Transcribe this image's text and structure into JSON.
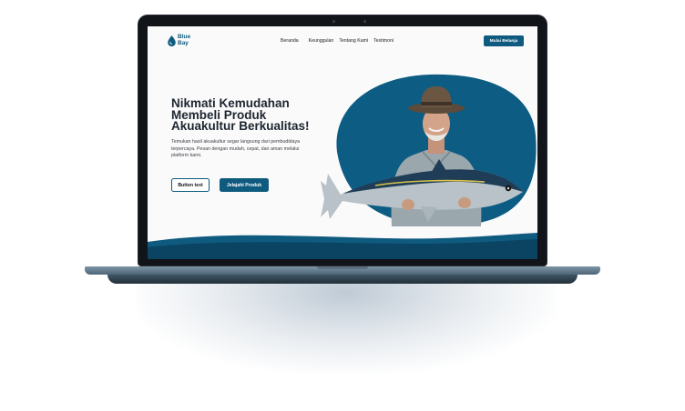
{
  "brand": {
    "line1": "Blue",
    "line2": "Bay"
  },
  "nav": {
    "items": [
      "Beranda",
      "Keunggulan",
      "Tentang Kami",
      "Testimoni"
    ],
    "cta_label": "Mulai Belanja"
  },
  "hero": {
    "title_lines": [
      "Nikmati Kemudahan",
      "Membeli Produk",
      "Akuakultur Berkualitas!"
    ],
    "description": "Temukan hasil akuakultur segar langsung dari pembudidaya terpercaya. Pesan dengan mudah, cepat, dan aman melalui platform kami.",
    "button_outline_label": "Button text",
    "button_primary_label": "Jelajahi Produk"
  },
  "colors": {
    "brand": "#0f5a7f",
    "blob": "#0d5c83",
    "text_dark": "#1d2530"
  },
  "icons": [
    "water-drop-icon"
  ]
}
